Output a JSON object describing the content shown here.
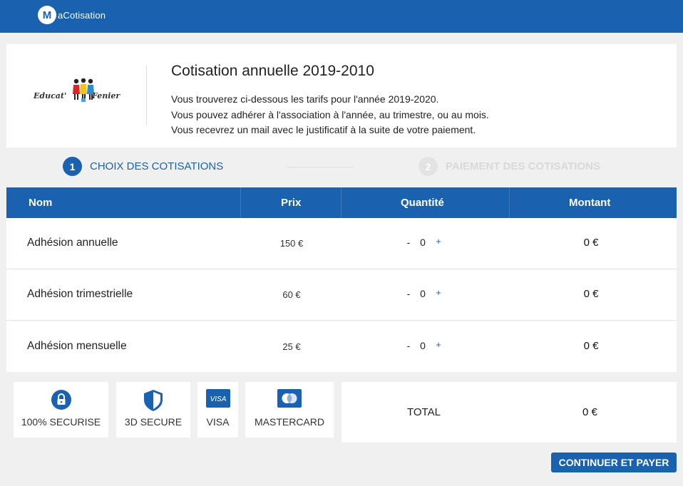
{
  "app": {
    "brand_mark": "M",
    "brand_name": "aCotisation",
    "accent_color": "#1a62b0",
    "brand_logo_icon": "macotisation-logo-icon"
  },
  "intro": {
    "org_name_left": "Educat'",
    "org_name_right": "Fenier",
    "title": "Cotisation annuelle 2019-2010",
    "lines": [
      "Vous trouverez ci-dessous les tarifs pour l'année 2019-2020.",
      "Vous pouvez adhérer à l'association à l'année, au trimestre, ou au mois.",
      "Vous recevrez un mail avec le justificatif à la suite de votre paiement."
    ]
  },
  "steps": [
    {
      "number": "1",
      "label": "CHOIX DES COTISATIONS",
      "state": "active"
    },
    {
      "number": "2",
      "label": "PAIEMENT DES COTISATIONS",
      "state": "inactive"
    }
  ],
  "table": {
    "headers": [
      "Nom",
      "Prix",
      "Quantité",
      "Montant"
    ],
    "rows": [
      {
        "name": "Adhésion annuelle",
        "price": "150 €",
        "minus": "-",
        "quantity": "0",
        "plus": "+",
        "amount": "0 €"
      },
      {
        "name": "Adhésion trimestrielle",
        "price": "60 €",
        "minus": "-",
        "quantity": "0",
        "plus": "+",
        "amount": "0 €"
      },
      {
        "name": "Adhésion mensuelle",
        "price": "25 €",
        "minus": "-",
        "quantity": "0",
        "plus": "+",
        "amount": "0 €"
      }
    ]
  },
  "badges": [
    {
      "label": "100% SECURISE",
      "icon": "lock-icon"
    },
    {
      "label": "3D SECURE",
      "icon": "shield-icon"
    },
    {
      "label": "VISA",
      "icon": "visa-card-icon",
      "icon_text": "VISA"
    },
    {
      "label": "MASTERCARD",
      "icon": "mastercard-icon"
    }
  ],
  "total": {
    "label": "TOTAL",
    "amount": "0 €"
  },
  "actions": {
    "pay_label": "CONTINUER ET PAYER"
  }
}
